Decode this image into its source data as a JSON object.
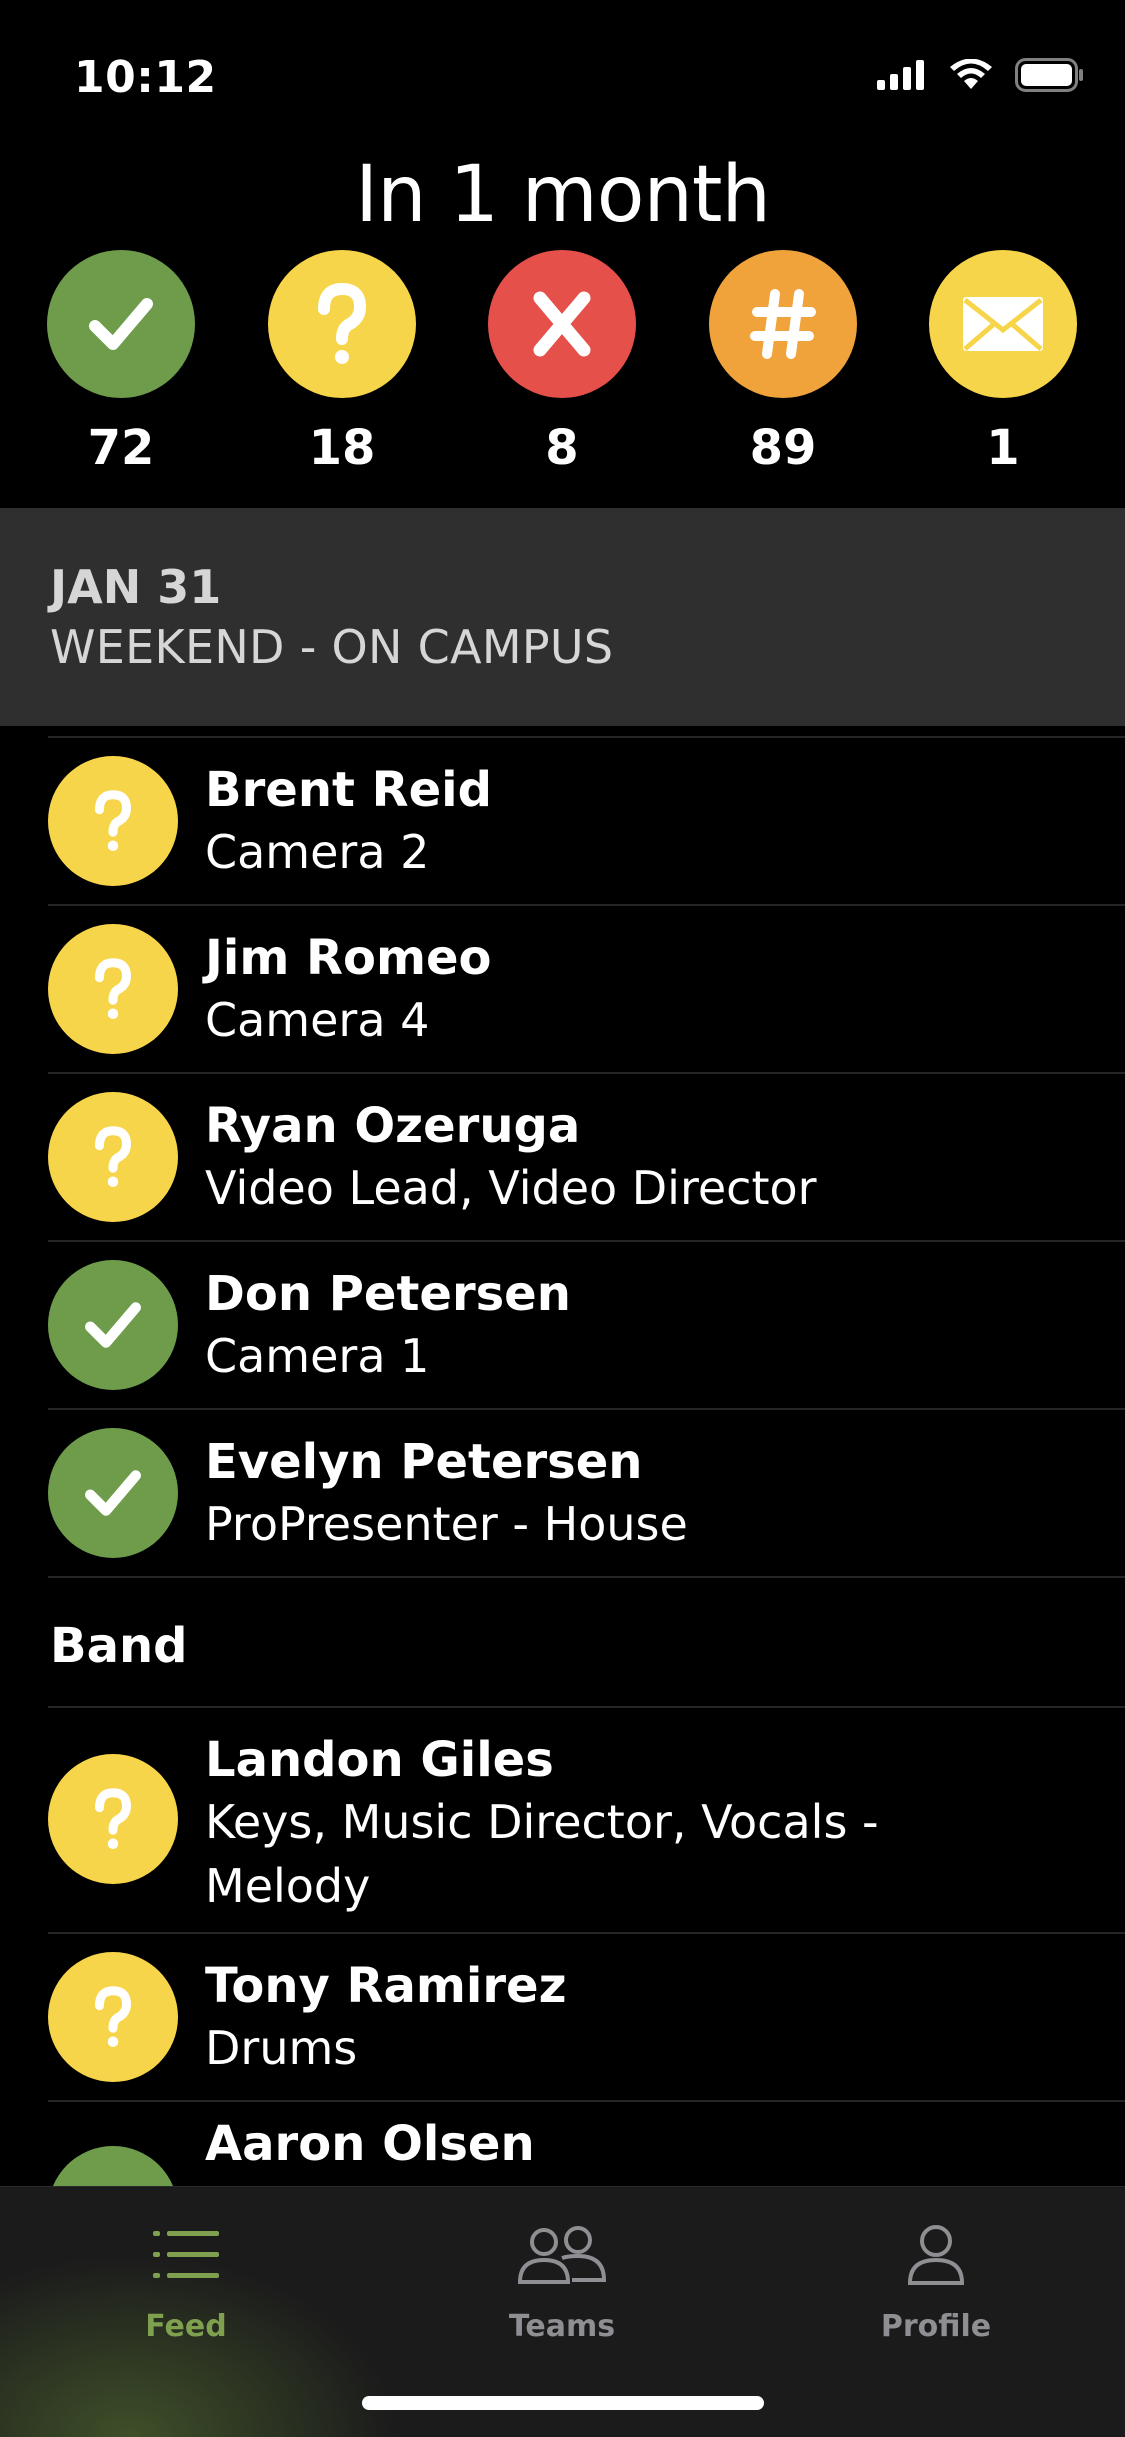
{
  "status_bar": {
    "time": "10:12",
    "icons": [
      "cellular-signal-icon",
      "wifi-icon",
      "battery-icon"
    ]
  },
  "summary": {
    "title": "In 1 month",
    "counts": [
      {
        "icon": "check-icon",
        "glyph": "✓",
        "color": "#6e9c4b",
        "value": "72"
      },
      {
        "icon": "question-icon",
        "glyph": "?",
        "color": "#f7d54a",
        "value": "18"
      },
      {
        "icon": "x-icon",
        "glyph": "X",
        "color": "#e5504a",
        "value": "8"
      },
      {
        "icon": "hash-icon",
        "glyph": "#",
        "color": "#f0a33a",
        "value": "89"
      },
      {
        "icon": "mail-icon",
        "glyph": "",
        "color": "#f7d54a",
        "value": "1"
      }
    ]
  },
  "event": {
    "date": "JAN 31",
    "name": "WEEKEND - ON CAMPUS"
  },
  "people": [
    {
      "name": "Brent Reid",
      "role": "Camera 2",
      "status": "question",
      "color": "#f7d54a"
    },
    {
      "name": "Jim Romeo",
      "role": "Camera 4",
      "status": "question",
      "color": "#f7d54a"
    },
    {
      "name": "Ryan Ozeruga",
      "role": "Video Lead, Video Director",
      "status": "question",
      "color": "#f7d54a"
    },
    {
      "name": "Don Petersen",
      "role": "Camera 1",
      "status": "check",
      "color": "#6e9c4b"
    },
    {
      "name": "Evelyn Petersen",
      "role": "ProPresenter - House",
      "status": "check",
      "color": "#6e9c4b"
    }
  ],
  "band": {
    "label": "Band",
    "people": [
      {
        "name": "Landon Giles",
        "role": "Keys, Music Director, Vocals - Melody",
        "status": "question",
        "color": "#f7d54a"
      },
      {
        "name": "Tony Ramirez",
        "role": "Drums",
        "status": "question",
        "color": "#f7d54a"
      },
      {
        "name": "Aaron Olsen",
        "role": "",
        "status": "check",
        "color": "#6e9c4b"
      }
    ]
  },
  "tabs": [
    {
      "label": "Feed",
      "icon": "list-icon",
      "active": true
    },
    {
      "label": "Teams",
      "icon": "people-icon",
      "active": false
    },
    {
      "label": "Profile",
      "icon": "person-icon",
      "active": false
    }
  ],
  "colors": {
    "accent_green": "#6e9c4b",
    "active_tab": "#7fa04f",
    "inactive_tab": "#8e8e93",
    "header_bg": "#2f2f2f",
    "question_yellow": "#f7d54a",
    "declined_red": "#e5504a",
    "hash_orange": "#f0a33a"
  }
}
